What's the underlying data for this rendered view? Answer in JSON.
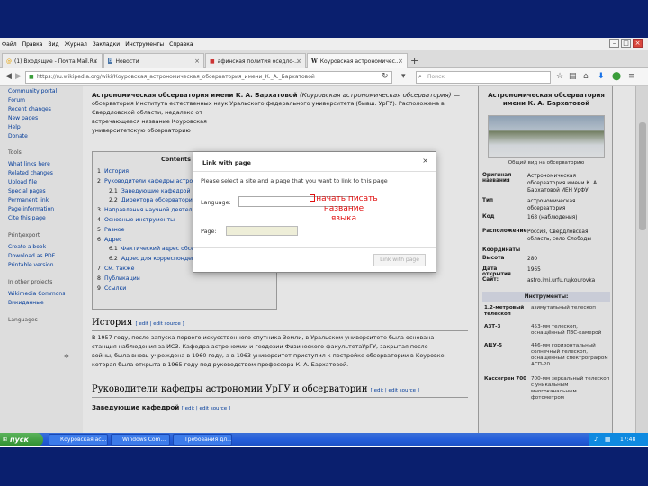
{
  "browser": {
    "menu": [
      "Файл",
      "Правка",
      "Вид",
      "Журнал",
      "Закладки",
      "Инструменты",
      "Справка"
    ],
    "tabs": [
      {
        "label": "(1) Входящие - Почта Mail.Ru",
        "active": false
      },
      {
        "label": "Новости",
        "active": false
      },
      {
        "label": "афинская полития оседло-...",
        "active": false
      },
      {
        "label": "Коуровская астрономичес...",
        "active": true
      }
    ],
    "url": "https://ru.wikipedia.org/wiki/Коуровская_астрономическая_обсерватория_имени_К._А._Бархатовой",
    "search_placeholder": "Поиск"
  },
  "sidebar": {
    "items": [
      {
        "label": "Community portal",
        "header": false
      },
      {
        "label": "Forum",
        "header": false
      },
      {
        "label": "Recent changes",
        "header": false
      },
      {
        "label": "New pages",
        "header": false
      },
      {
        "label": "Help",
        "header": false
      },
      {
        "label": "Donate",
        "header": false
      },
      {
        "label": "Tools",
        "header": true
      },
      {
        "label": "What links here",
        "header": false
      },
      {
        "label": "Related changes",
        "header": false
      },
      {
        "label": "Upload file",
        "header": false
      },
      {
        "label": "Special pages",
        "header": false
      },
      {
        "label": "Permanent link",
        "header": false
      },
      {
        "label": "Page information",
        "header": false
      },
      {
        "label": "Cite this page",
        "header": false
      },
      {
        "label": "Print/export",
        "header": true
      },
      {
        "label": "Create a book",
        "header": false
      },
      {
        "label": "Download as PDF",
        "header": false
      },
      {
        "label": "Printable version",
        "header": false
      },
      {
        "label": "In other projects",
        "header": true
      },
      {
        "label": "Wikimedia Commons",
        "header": false
      },
      {
        "label": "Викиданные",
        "header": false
      },
      {
        "label": "Languages",
        "header": true
      }
    ]
  },
  "article": {
    "title_bold": "Астрономическая обсерватория имени К. А. Бархатовой",
    "title_italic": "(Коуровская астрономическая обсерватория)",
    "lead_lines": [
      "обсерватория Института естественных наук Уральского федерального университета (бывш. УрГУ). Расположена в",
      "Свердловской области, недалеко от",
      "встречающееся название Коуровская",
      "университетскую обсерваторию"
    ],
    "toc_title": "Contents",
    "toc": [
      {
        "num": "1",
        "text": "История",
        "level": 1
      },
      {
        "num": "2",
        "text": "Руководители кафедры астрономии",
        "level": 1
      },
      {
        "num": "2.1",
        "text": "Заведующие кафедрой",
        "level": 2
      },
      {
        "num": "2.2",
        "text": "Директора обсерватории",
        "level": 2
      },
      {
        "num": "3",
        "text": "Направления научной деятельности",
        "level": 1
      },
      {
        "num": "4",
        "text": "Основные инструменты",
        "level": 1
      },
      {
        "num": "5",
        "text": "Разное",
        "level": 1
      },
      {
        "num": "6",
        "text": "Адрес",
        "level": 1
      },
      {
        "num": "6.1",
        "text": "Фактический адрес обсерватории",
        "level": 2
      },
      {
        "num": "6.2",
        "text": "Адрес для корреспонденции",
        "level": 2
      },
      {
        "num": "7",
        "text": "См. также",
        "level": 1
      },
      {
        "num": "8",
        "text": "Публикации",
        "level": 1
      },
      {
        "num": "9",
        "text": "Ссылки",
        "level": 1
      }
    ],
    "history_heading": "История",
    "edit_links": "[ edit | edit source ]",
    "history_lines": [
      "В 1957 году, после запуска первого искусственного спутника Земли, в Уральском университете была основана",
      "станция наблюдения за ИСЗ. Кафедра астрономии и геодезии Физического факультетаУрГУ, закрытая после",
      "войны, была вновь учреждена в 1960 году, а в 1963 университет приступил к постройке обсерватории в Коуровке,",
      "которая была открыта в 1965 году под руководством профессора К. А. Бархатовой."
    ],
    "section2_heading": "Руководители кафедры астрономии УрГУ и обсерватории",
    "subsection_heading": "Заведующие кафедрой"
  },
  "infobox": {
    "title": "Астрономическая обсерватория имени К. А. Бархатовой",
    "caption": "Общий вид на обсерваторию",
    "rows": [
      {
        "key": "Оригинал названия",
        "value": "Астрономическая обсерватория имени К. А. Бархатовой ИЕН УрФУ"
      },
      {
        "key": "Тип",
        "value": "астрономическая обсерватория"
      },
      {
        "key": "Код",
        "value": "168 (наблюдения)"
      },
      {
        "key": "Расположение",
        "value": "Россия, Свердловская область, село Слободы"
      },
      {
        "key": "Координаты",
        "value": ""
      },
      {
        "key": "Высота",
        "value": "280"
      },
      {
        "key": "Дата открытия",
        "value": "1965"
      },
      {
        "key": "Сайт:",
        "value": "astro.imi.urfu.ru/kourovka"
      }
    ],
    "instruments_title": "Инструменты:",
    "instruments": [
      {
        "name": "1.2-метровый телескоп",
        "desc": "азимутальный телескоп"
      },
      {
        "name": "АЗТ-3",
        "desc": "453-мм телескоп, оснащённый ПЗС-камерой"
      },
      {
        "name": "АЦУ-5",
        "desc": "446-мм горизонтальный солнечный телескоп, оснащённый спектрографом АСП-20"
      },
      {
        "name": "Кассегрен 700",
        "desc": "700-мм зеркальный телескоп с уникальным многоканальным фотометром"
      }
    ]
  },
  "dialog": {
    "title": "Link with page",
    "close": "×",
    "instruction": "Please select a site and a page that you want to link to this page",
    "language_label": "Language:",
    "page_label": "Page:",
    "button": "Link with page"
  },
  "annotation": {
    "lines": [
      "начать писать",
      "название",
      "языка"
    ],
    "color": "#e01010"
  },
  "taskbar": {
    "start": "пуск",
    "items": [
      "Коуровская ас...",
      "Windows Com...",
      "Требования дл..."
    ],
    "clock": "17:48"
  }
}
